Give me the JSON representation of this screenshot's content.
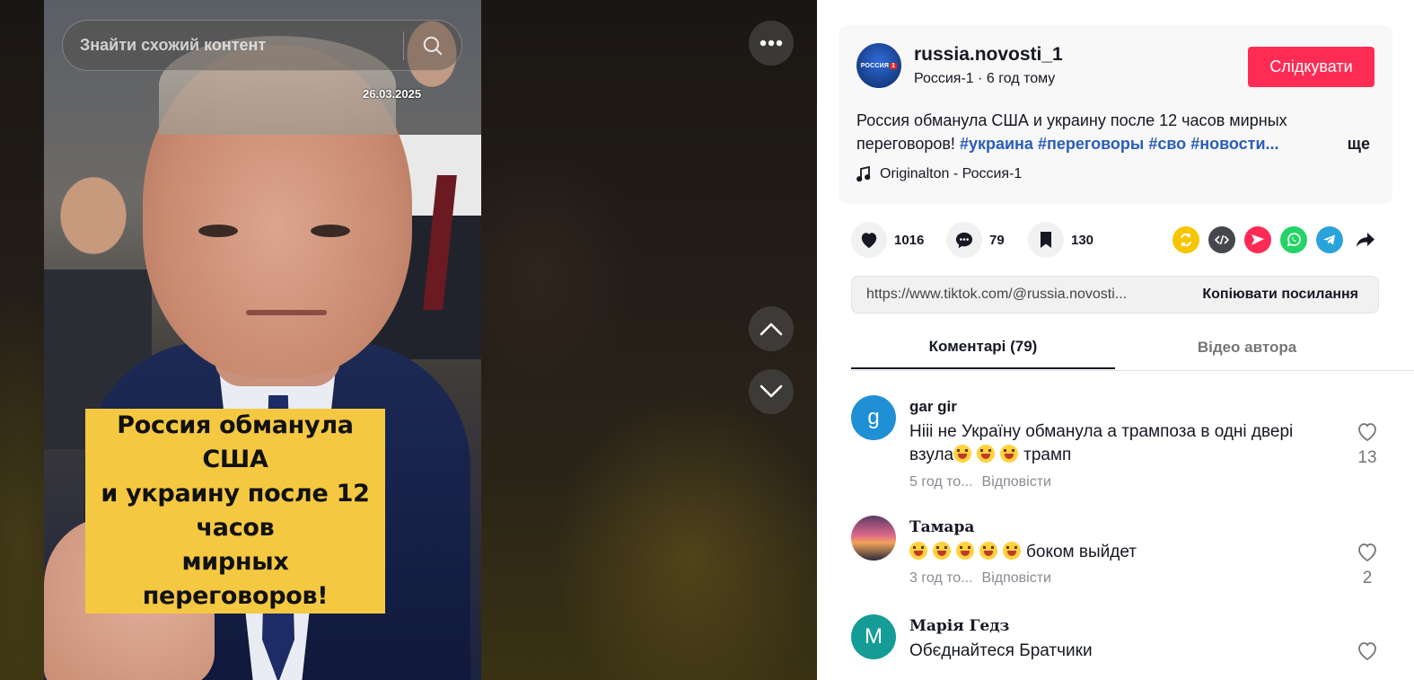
{
  "video": {
    "search_placeholder": "Знайти схожий контент",
    "date_stamp": "26.03.2025",
    "caption_lines": [
      "Россия обманула США",
      "и украину после 12 часов",
      "мирных переговоров!"
    ]
  },
  "author": {
    "username": "russia.novosti_1",
    "display_name": "Россия-1",
    "time_ago": "6 год тому",
    "follow_label": "Слідкувати",
    "avatar_logo_text": "РОССИЯ",
    "avatar_logo_num": "1"
  },
  "description": {
    "text": "Россия обманула США и украину после 12 часов мирных переговоров!",
    "hashtags": [
      "#украина",
      "#переговоры",
      "#сво",
      "#новости"
    ],
    "ellipsis": "...",
    "more_label": "ще",
    "music": "Originalton - Россия-1"
  },
  "stats": {
    "likes": "1016",
    "comments": "79",
    "saves": "130"
  },
  "share_colors": {
    "repost": "#f7c600",
    "embed": "#45474d",
    "send": "#fe2c55",
    "whatsapp": "#25d366",
    "telegram": "#2aa3db"
  },
  "link": {
    "url": "https://www.tiktok.com/@russia.novosti...",
    "copy_label": "Копіювати посилання"
  },
  "tabs": [
    {
      "label": "Коментарі (79)"
    },
    {
      "label": "Відео автора"
    }
  ],
  "comments": [
    {
      "avatar_letter": "g",
      "avatar_color": "#1f8fd6",
      "name": "gar gir",
      "text_before": "Нііі не Україну обманула а трампоза в одні двері взула",
      "text_after": "трамп",
      "emoji_count": 3,
      "time": "5 год то...",
      "reply_label": "Відповісти",
      "likes": "13"
    },
    {
      "avatar_letter": "",
      "avatar_color": "#3a2a4a",
      "name": "Тамара",
      "text_before": "",
      "text_after": "боком выйдет",
      "emoji_count": 5,
      "time": "3 год то...",
      "reply_label": "Відповісти",
      "likes": "2"
    },
    {
      "avatar_letter": "M",
      "avatar_color": "#159c96",
      "name": "Марія Гедз",
      "text_before": "Обєднайтеся Братчики",
      "text_after": "",
      "emoji_count": 0,
      "time": "",
      "reply_label": "",
      "likes": ""
    }
  ]
}
